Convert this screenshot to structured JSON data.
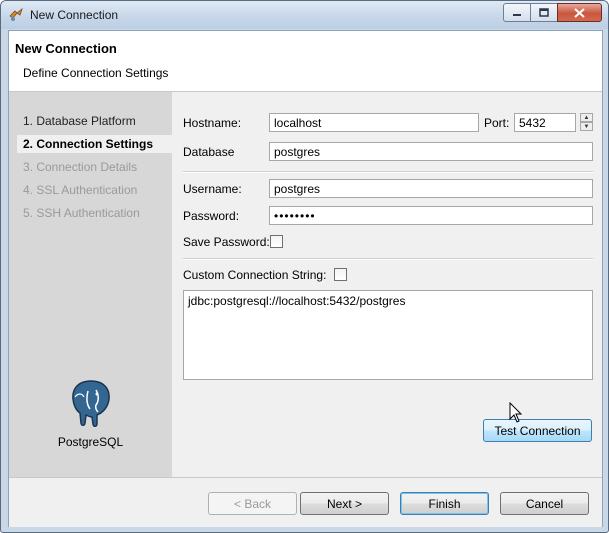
{
  "window": {
    "title": "New Connection",
    "controls": [
      "minimize-icon",
      "maximize-icon",
      "close-icon"
    ]
  },
  "header": {
    "title": "New Connection",
    "subtitle": "Define Connection Settings"
  },
  "sidebar": {
    "steps": [
      {
        "label": "1. Database Platform",
        "state": "normal"
      },
      {
        "label": "2. Connection Settings",
        "state": "active"
      },
      {
        "label": "3. Connection Details",
        "state": "disabled"
      },
      {
        "label": "4. SSL Authentication",
        "state": "disabled"
      },
      {
        "label": "5. SSH Authentication",
        "state": "disabled"
      }
    ],
    "logo_label": "PostgreSQL"
  },
  "form": {
    "hostname_label": "Hostname:",
    "hostname_value": "localhost",
    "port_label": "Port:",
    "port_value": "5432",
    "database_label": "Database",
    "database_value": "postgres",
    "username_label": "Username:",
    "username_value": "postgres",
    "password_label": "Password:",
    "password_value": "••••••••",
    "save_password_label": "Save Password:",
    "save_password_checked": false,
    "custom_string_label": "Custom Connection String:",
    "custom_string_checked": false,
    "connection_string": "jdbc:postgresql://localhost:5432/postgres",
    "test_button": "Test Connection"
  },
  "footer": {
    "back": "< Back",
    "next": "Next >",
    "finish": "Finish",
    "cancel": "Cancel"
  },
  "colors": {
    "title_bar": "#c6d6e8",
    "sidebar": "#d7d7d7",
    "accent": "#3c7fb1",
    "logo_blue": "#336791"
  }
}
